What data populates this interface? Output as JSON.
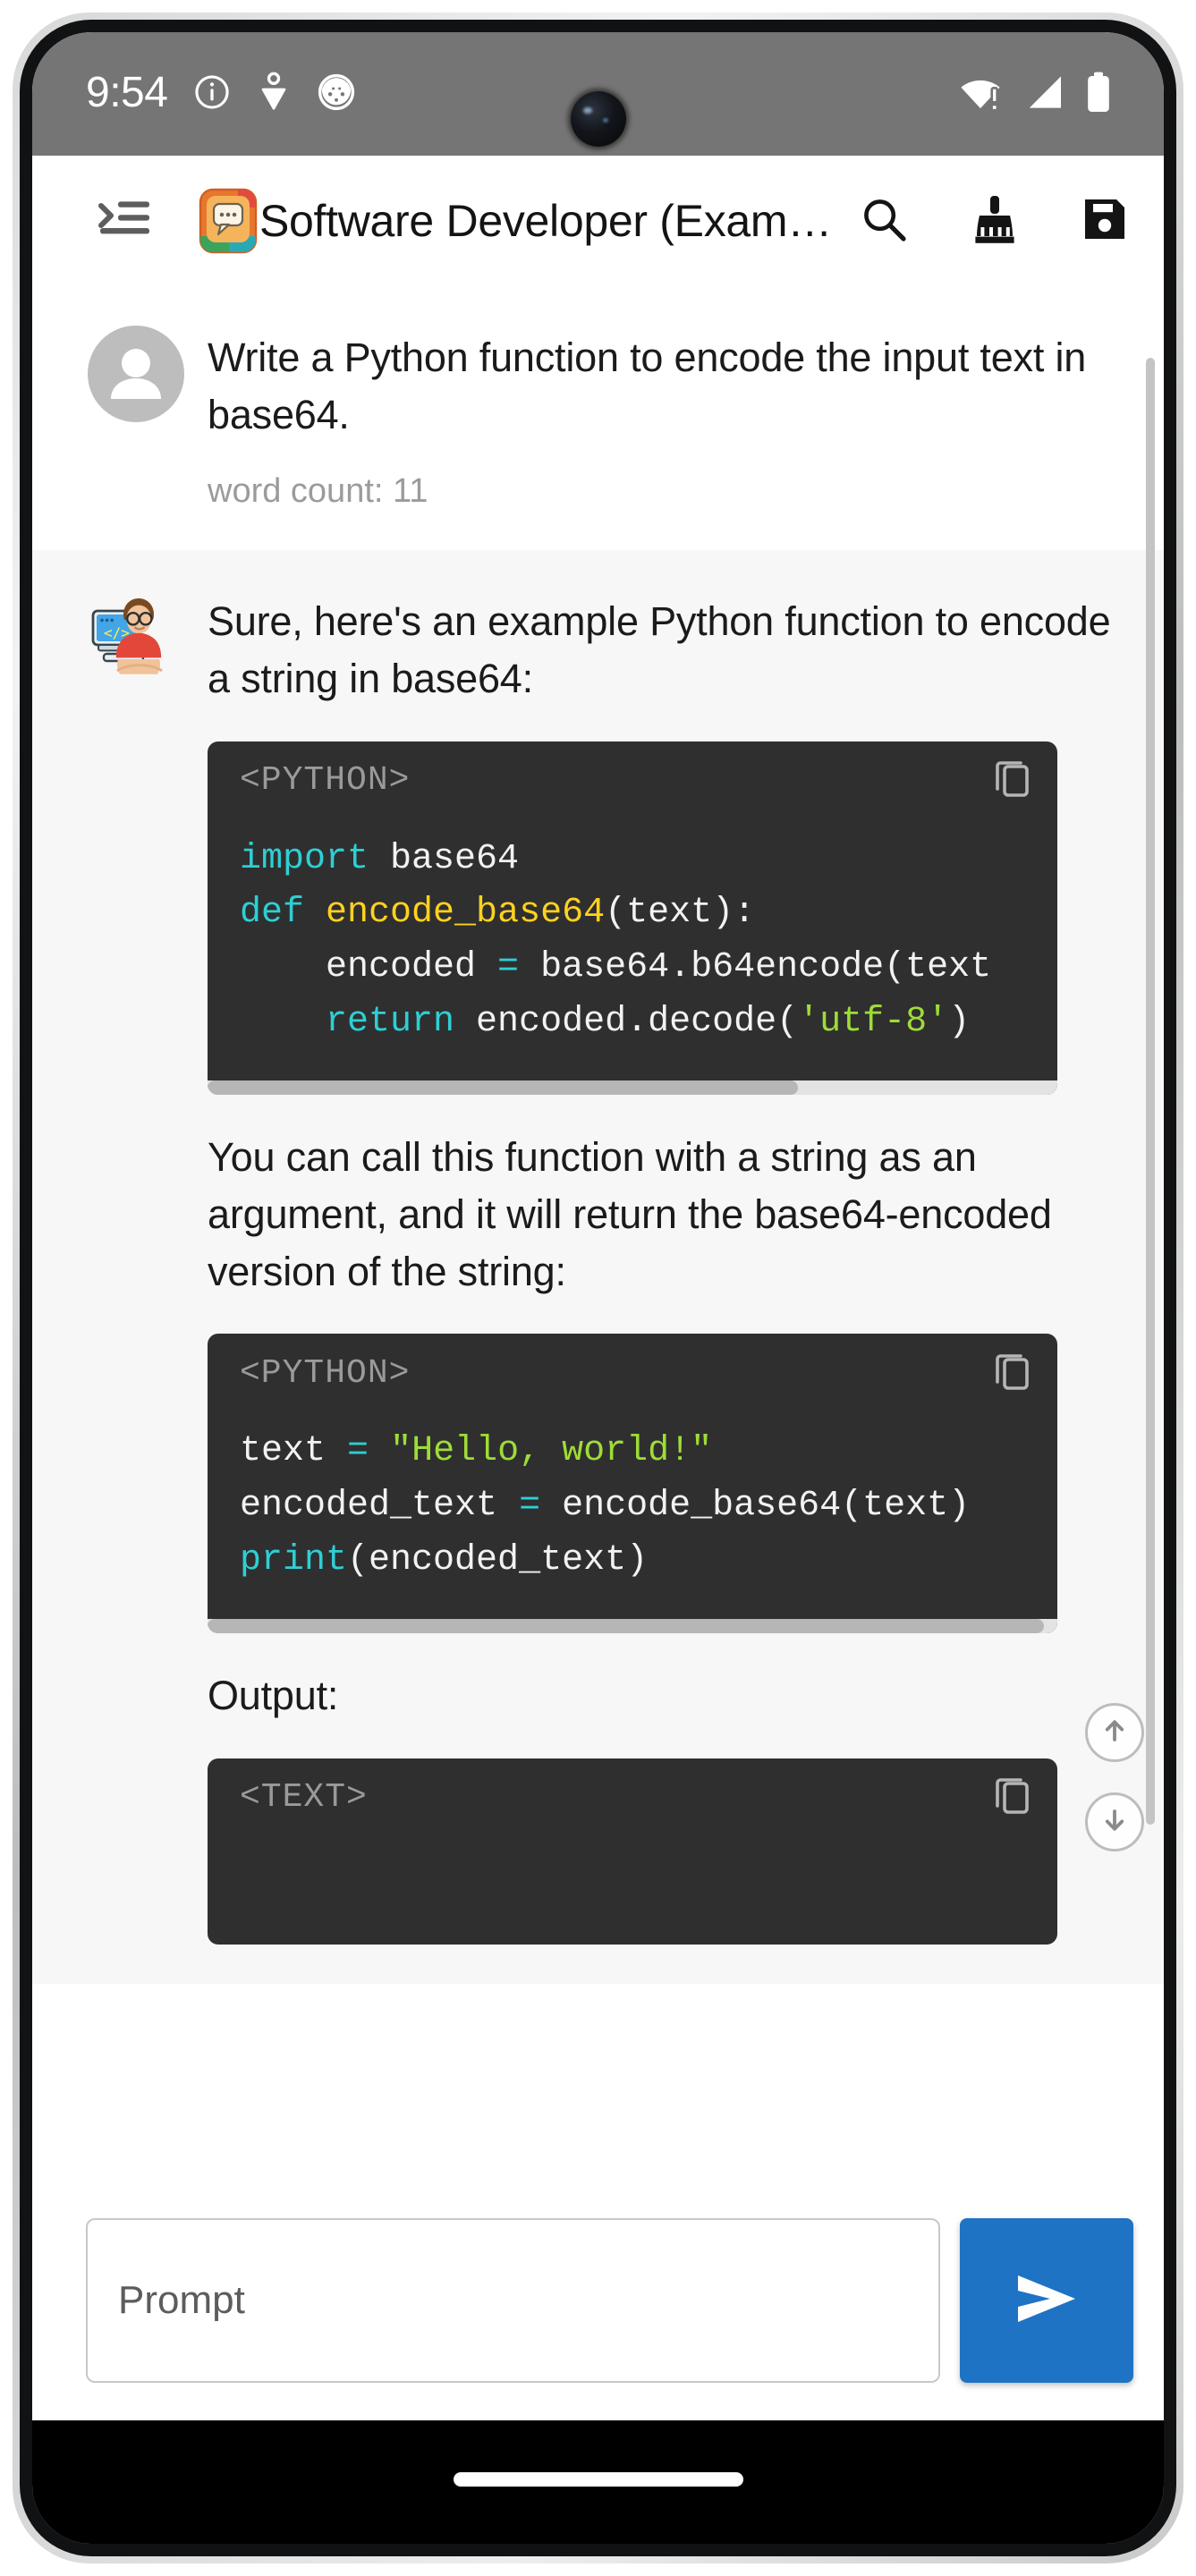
{
  "status_bar": {
    "time": "9:54",
    "left_icons": [
      "info-circle-icon",
      "heartbeat-icon",
      "ladybug-icon"
    ],
    "right_icons": [
      "wifi-warning-icon",
      "cellular-signal-icon",
      "battery-full-icon"
    ],
    "background": "#757575"
  },
  "app_bar": {
    "menu_icon": "menu-open-icon",
    "app_icon": "chat-assistant-icon",
    "title": "Software Developer (Exam…",
    "actions": [
      {
        "name": "search-icon",
        "label": "Search"
      },
      {
        "name": "broom-icon",
        "label": "Clear chat"
      },
      {
        "name": "save-icon",
        "label": "Save"
      }
    ]
  },
  "conversation": {
    "user_message": {
      "avatar": "user-avatar-icon",
      "text": "Write a Python function to encode the input text in base64.",
      "word_count": "word count: 11"
    },
    "assistant_message": {
      "avatar": "developer-avatar-icon",
      "paragraph_1": "Sure, here's an example Python function to encode a string in base64:",
      "paragraph_2": "You can call this function with a string as an argument, and it will return the base64-encoded version of the string:",
      "paragraph_3": "Output:"
    },
    "code_blocks": [
      {
        "language_label": "<PYTHON>",
        "copy_icon": "copy-icon",
        "lines": [
          [
            {
              "t": "import",
              "c": "kw"
            },
            {
              "t": " base64",
              "c": "pl"
            }
          ],
          [
            {
              "t": "",
              "c": "pl"
            }
          ],
          [
            {
              "t": "def",
              "c": "kw"
            },
            {
              "t": " ",
              "c": "pl"
            },
            {
              "t": "encode_base64",
              "c": "fn"
            },
            {
              "t": "(text):",
              "c": "pl"
            }
          ],
          [
            {
              "t": "    encoded ",
              "c": "pl"
            },
            {
              "t": "=",
              "c": "op"
            },
            {
              "t": " base64.b64encode(text",
              "c": "pl"
            }
          ],
          [
            {
              "t": "    ",
              "c": "pl"
            },
            {
              "t": "return",
              "c": "kw"
            },
            {
              "t": " encoded.decode(",
              "c": "pl"
            },
            {
              "t": "'utf-8'",
              "c": "str"
            },
            {
              "t": ")",
              "c": "pl"
            }
          ]
        ]
      },
      {
        "language_label": "<PYTHON>",
        "copy_icon": "copy-icon",
        "lines": [
          [
            {
              "t": "text ",
              "c": "pl"
            },
            {
              "t": "=",
              "c": "op"
            },
            {
              "t": " ",
              "c": "pl"
            },
            {
              "t": "\"Hello, world!\"",
              "c": "str"
            }
          ],
          [
            {
              "t": "encoded_text ",
              "c": "pl"
            },
            {
              "t": "=",
              "c": "op"
            },
            {
              "t": " encode_base64(text)",
              "c": "pl"
            }
          ],
          [
            {
              "t": "print",
              "c": "kw"
            },
            {
              "t": "(encoded_text)",
              "c": "pl"
            }
          ]
        ]
      },
      {
        "language_label": "<TEXT>",
        "copy_icon": "copy-icon",
        "lines": []
      }
    ]
  },
  "scroll_buttons": [
    {
      "name": "scroll-to-top-button",
      "icon": "arrow-up-icon"
    },
    {
      "name": "scroll-to-bottom-button",
      "icon": "arrow-down-icon"
    }
  ],
  "prompt_bar": {
    "placeholder": "Prompt",
    "value": "",
    "send_icon": "send-arrow-icon",
    "send_color": "#1f73c4"
  },
  "nav_bar": {
    "gesture_pill": "home-gesture-pill"
  }
}
